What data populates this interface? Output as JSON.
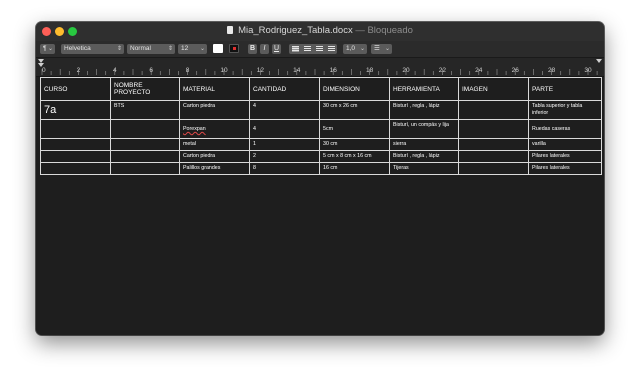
{
  "window": {
    "file_name": "Mia_Rodriguez_Tabla.docx",
    "separator": " — ",
    "status": "Bloqueado"
  },
  "toolbar": {
    "list_style": "¶",
    "font_family": "Helvetica",
    "font_style": "Normal",
    "font_size": "12",
    "bold": "B",
    "italic": "I",
    "underline": "U",
    "line_spacing": "1,0",
    "list_button": "☰"
  },
  "ruler": {
    "labels": [
      "0",
      "2",
      "4",
      "6",
      "8",
      "10",
      "12",
      "14",
      "16",
      "18",
      "20",
      "22",
      "24",
      "26",
      "28",
      "30"
    ]
  },
  "table": {
    "headers": [
      "CURSO",
      "NOMBRE PROYECTO",
      "MATERIAL",
      "CANTIDAD",
      "DIMENSION",
      "HERRAMIENTA",
      "IMAGEN",
      "PARTE"
    ],
    "rows": [
      [
        "7a",
        "BTS",
        "Carton piedra",
        "4",
        "30 cm x 26 cm",
        "Bisturí , regla , lápiz",
        "",
        "Tabla superior y tabla inferior"
      ],
      [
        "",
        "",
        "Porexpan",
        "4",
        "5cm",
        "Bisturí,  un compás y lija",
        "",
        "Ruedas caseras"
      ],
      [
        "",
        "",
        "metal",
        "1",
        "30 cm",
        "sierra",
        "",
        "varilla"
      ],
      [
        "",
        "",
        "Carton piedra",
        "2",
        "5 cm x 8 cm x 16 cm",
        "Bisturí , regla , lápiz",
        "",
        "Pilares laterales"
      ],
      [
        "",
        "",
        "Palillos grandes",
        "8",
        "16 cm",
        "Tijeras",
        "",
        "Pilares laterales"
      ]
    ]
  },
  "colors": {
    "background": "#1e1e1e",
    "text": "#ffffff",
    "grid": "#dadada",
    "close": "#fe5f57",
    "minimize": "#febc2e",
    "zoom": "#28c840"
  }
}
